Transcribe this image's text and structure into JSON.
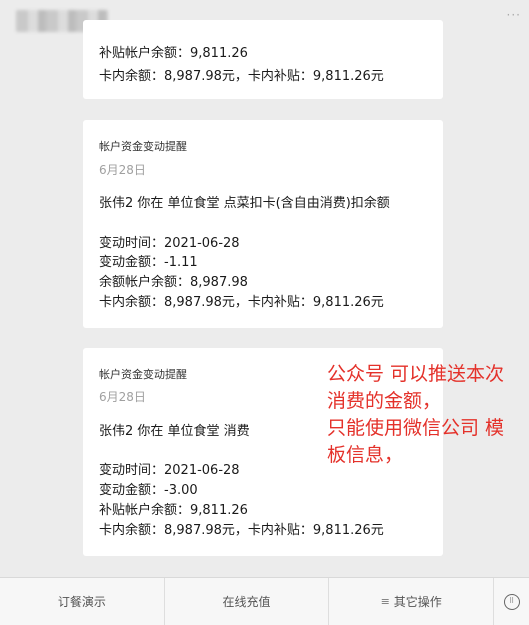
{
  "header": {
    "more_icon": "more-dots-icon"
  },
  "cards": [
    {
      "lines": [
        "补贴帐户余额：9,811.26",
        "卡内余额：8,987.98元，卡内补贴：9,811.26元"
      ]
    },
    {
      "title": "帐户资金变动提醒",
      "date": "6月28日",
      "summary": "张伟2 你在 单位食堂 点菜扣卡(含自由消费)扣余额",
      "lines": [
        "变动时间：2021-06-28",
        "变动金额：-1.11",
        "余额帐户余额：8,987.98",
        "卡内余额：8,987.98元，卡内补贴：9,811.26元"
      ]
    },
    {
      "title": "帐户资金变动提醒",
      "date": "6月28日",
      "summary": "张伟2 你在 单位食堂 消费",
      "lines": [
        "变动时间：2021-06-28",
        "变动金额：-3.00",
        "补贴帐户余额：9,811.26",
        "卡内余额：8,987.98元，卡内补贴：9,811.26元"
      ]
    }
  ],
  "annotation": {
    "color": "#e4312a",
    "lines": [
      "公众号 可以推送本次",
      "消费的金额，",
      "只能使用微信公司 模",
      "板信息，"
    ]
  },
  "bottom_menu": {
    "items": [
      "订餐演示",
      "在线充值",
      "其它操作"
    ],
    "menu_icon": "menu-lines-icon",
    "keyboard_icon": "keyboard-icon"
  }
}
